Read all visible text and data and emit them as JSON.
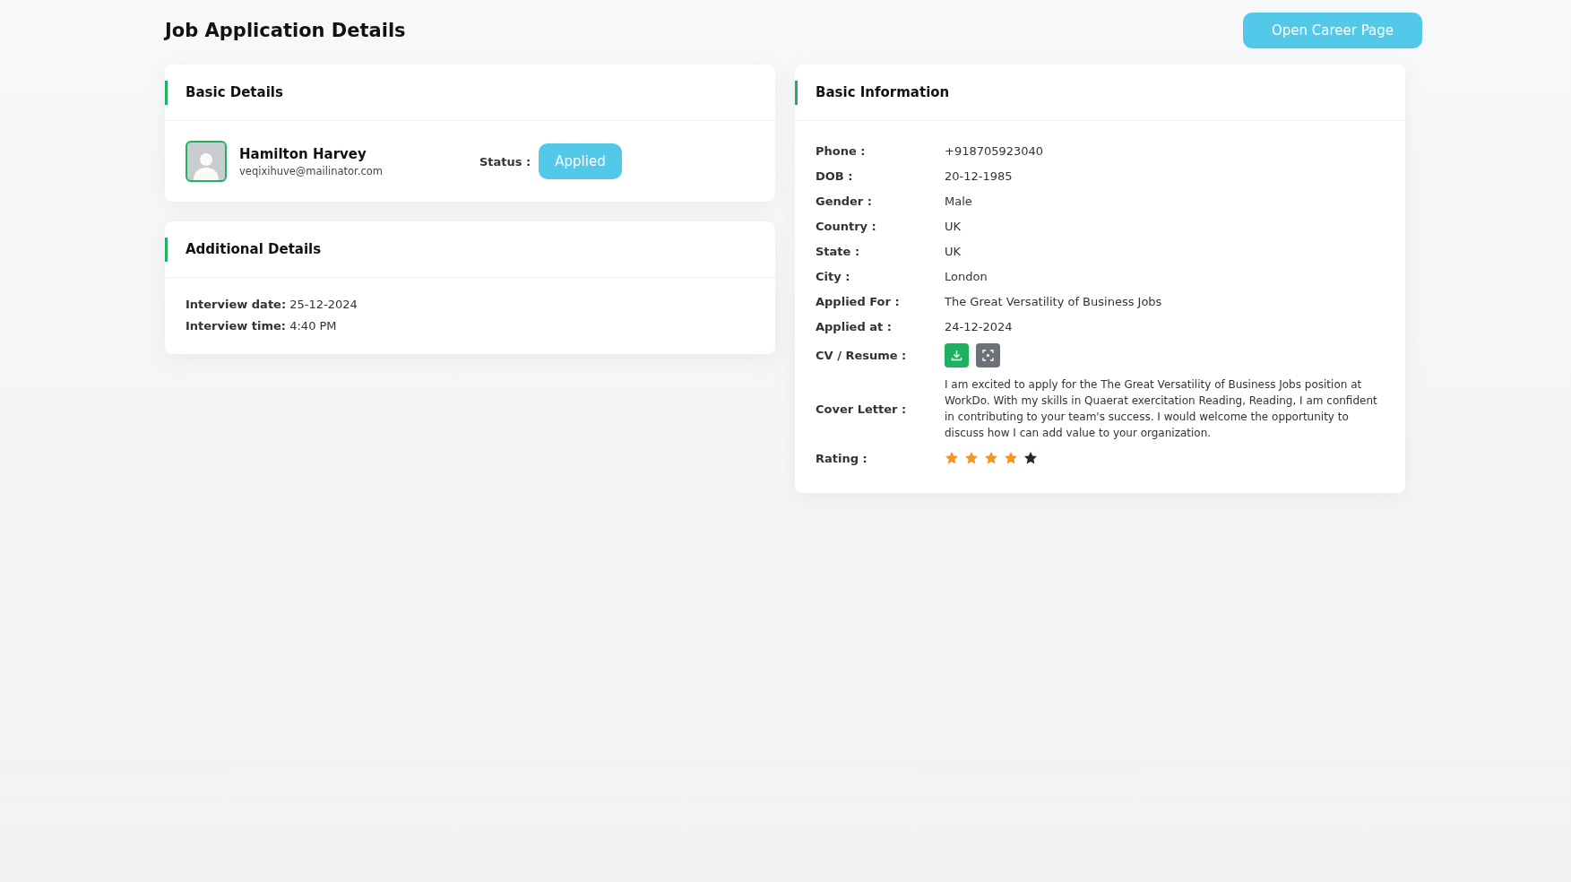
{
  "page": {
    "title": "Job Application Details",
    "action_button": "Open Career Page"
  },
  "basic_details": {
    "title": "Basic Details",
    "name": "Hamilton Harvey",
    "email": "veqixihuve@mailinator.com",
    "status_label": "Status :",
    "status": "Applied"
  },
  "additional_details": {
    "title": "Additional Details",
    "items": [
      {
        "label": "Interview date:",
        "value": "25-12-2024"
      },
      {
        "label": "Interview time:",
        "value": "4:40 PM"
      }
    ]
  },
  "basic_information": {
    "title": "Basic Information",
    "rows": [
      {
        "kind": "text",
        "label": "Phone :",
        "value": "+918705923040"
      },
      {
        "kind": "text",
        "label": "DOB :",
        "value": "20-12-1985"
      },
      {
        "kind": "text",
        "label": "Gender :",
        "value": "Male"
      },
      {
        "kind": "text",
        "label": "Country :",
        "value": "UK"
      },
      {
        "kind": "text",
        "label": "State :",
        "value": "UK"
      },
      {
        "kind": "text",
        "label": "City :",
        "value": "London"
      },
      {
        "kind": "text",
        "label": "Applied For :",
        "value": "The Great Versatility of Business Jobs"
      },
      {
        "kind": "text",
        "label": "Applied at :",
        "value": "24-12-2024"
      },
      {
        "kind": "files",
        "label": "CV / Resume :"
      },
      {
        "kind": "paragraph",
        "label": "Cover Letter :",
        "value": "I am excited to apply for the The Great Versatility of Business Jobs position at WorkDo. With my skills in Quaerat exercitation Reading, Reading, I am confident in contributing to your team's success. I would welcome the opportunity to discuss how I can add value to your organization."
      },
      {
        "kind": "rating",
        "label": "Rating :",
        "stars": 4
      }
    ]
  }
}
